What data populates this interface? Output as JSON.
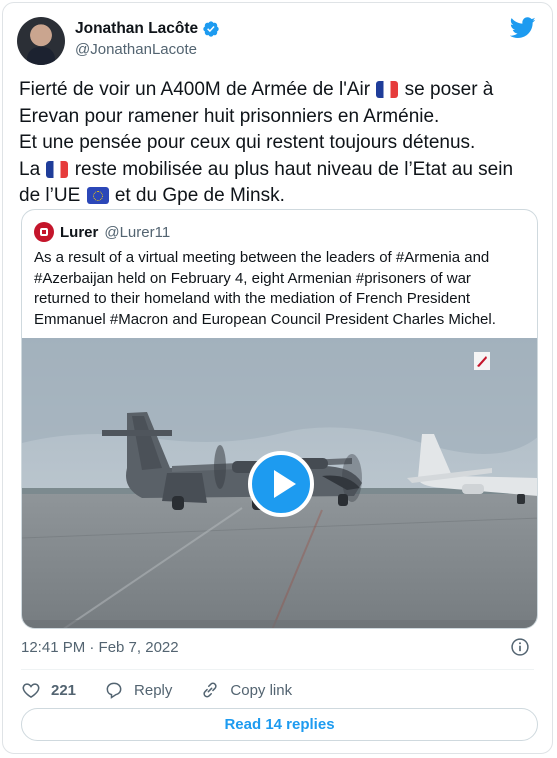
{
  "author": {
    "name": "Jonathan Lacôte",
    "handle": "@JonathanLacote",
    "verified": true
  },
  "tweet": {
    "line1_a": "Fierté de voir un A400M de Armée de l'Air",
    "line1_b": "se poser à",
    "line2": "Erevan pour ramener huit prisonniers en Arménie.",
    "line3": "Et une pensée pour ceux qui restent toujours détenus.",
    "line4_a": "La",
    "line4_b": "reste mobilisée au plus haut niveau de l’Etat au sein",
    "line5_a": "de l’UE",
    "line5_b": "et du Gpe de Minsk."
  },
  "quoted": {
    "name": "Lurer",
    "handle": "@Lurer11",
    "lines": [
      "As a result of a virtual meeting between the leaders of #Armenia and",
      "#Azerbaijan held on February 4, eight Armenian #prisoners of war",
      "returned to their homeland with the mediation of French President",
      "Emmanuel #Macron and European Council President Charles Michel."
    ]
  },
  "meta": {
    "timestamp": "12:41 PM · Feb 7, 2022"
  },
  "actions": {
    "likes": "221",
    "reply": "Reply",
    "copy_link": "Copy link"
  },
  "read_replies": "Read 14 replies",
  "colors": {
    "accent": "#1d9bf0",
    "like_red": "#f91880",
    "text": "#0f1419",
    "secondary": "#536471"
  },
  "icons": [
    "twitter-bird-icon",
    "verified-badge-icon",
    "play-icon",
    "info-icon",
    "heart-icon",
    "reply-icon",
    "link-icon",
    "flag-france-icon",
    "flag-eu-icon"
  ]
}
